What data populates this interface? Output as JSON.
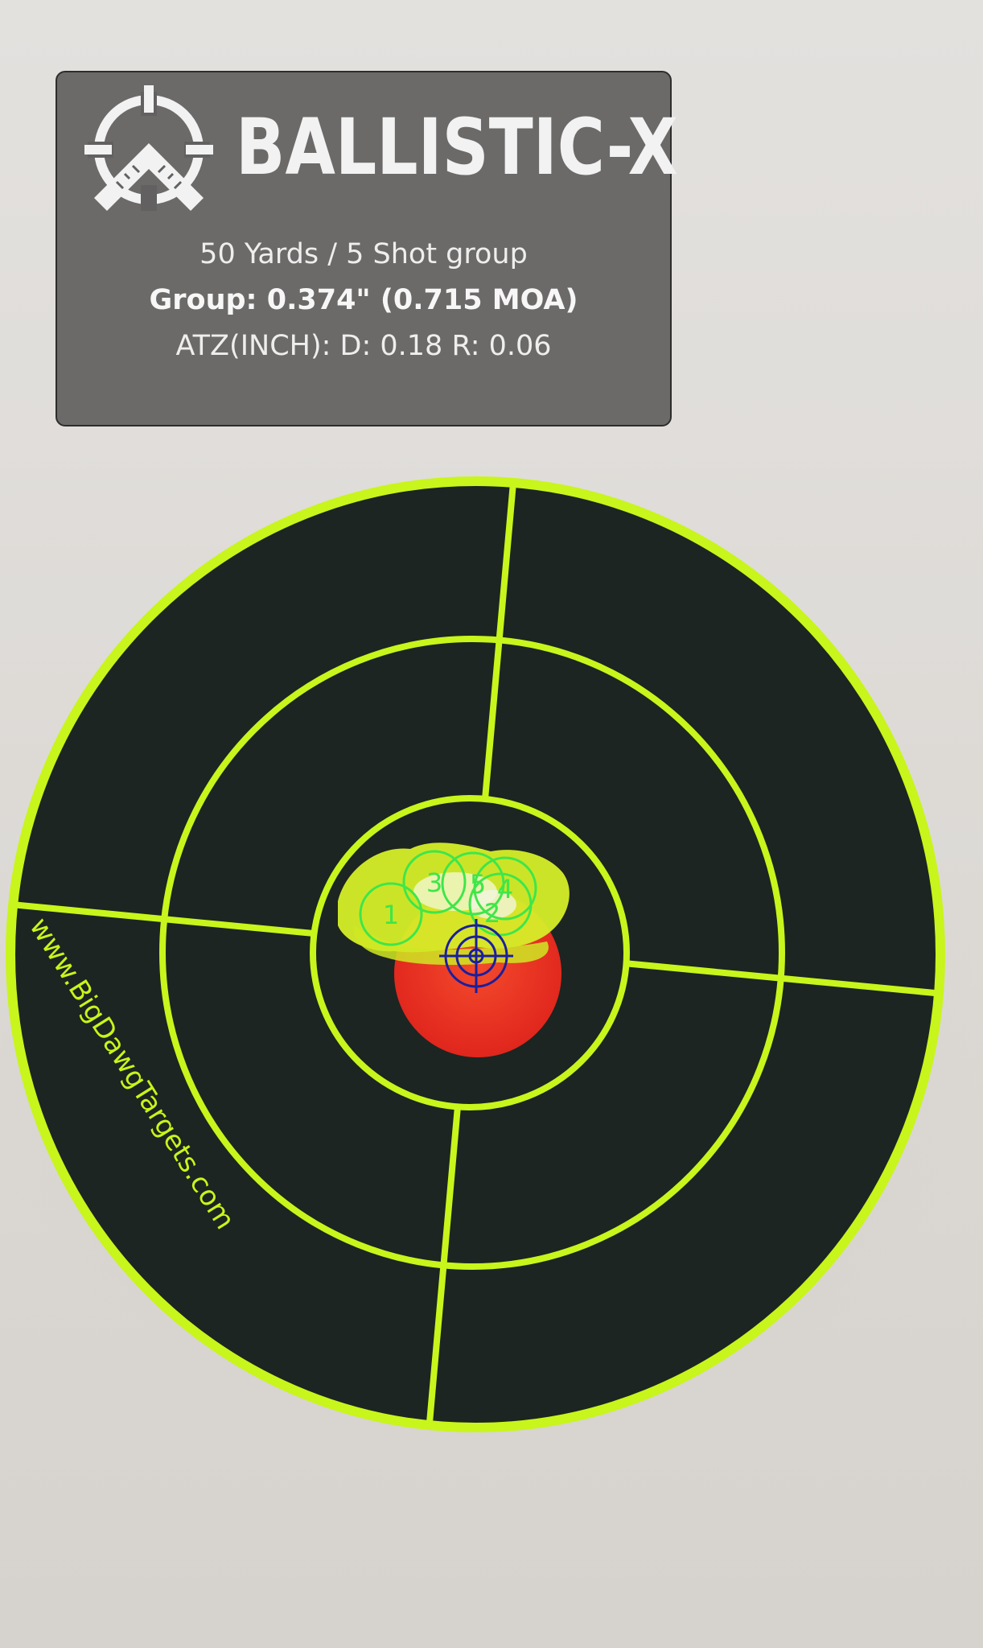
{
  "app": {
    "brand_name": "BALLISTIC-X"
  },
  "group_info": {
    "distance_line": "50 Yards / 5 Shot group",
    "group_line": "Group: 0.374\" (0.715 MOA)",
    "atz_line": "ATZ(INCH): D: 0.18 R: 0.06"
  },
  "target": {
    "watermark": "www.BigDawgTargets.com",
    "shots": [
      {
        "label": "1"
      },
      {
        "label": "2"
      },
      {
        "label": "3"
      },
      {
        "label": "4"
      },
      {
        "label": "5"
      }
    ]
  },
  "colors": {
    "ring": "#c8f51b",
    "target_fill": "#1c2521",
    "shot_marker": "#3ee64a",
    "group_center_marker": "#1a1f9e",
    "aim_point": "#ef3b25"
  }
}
